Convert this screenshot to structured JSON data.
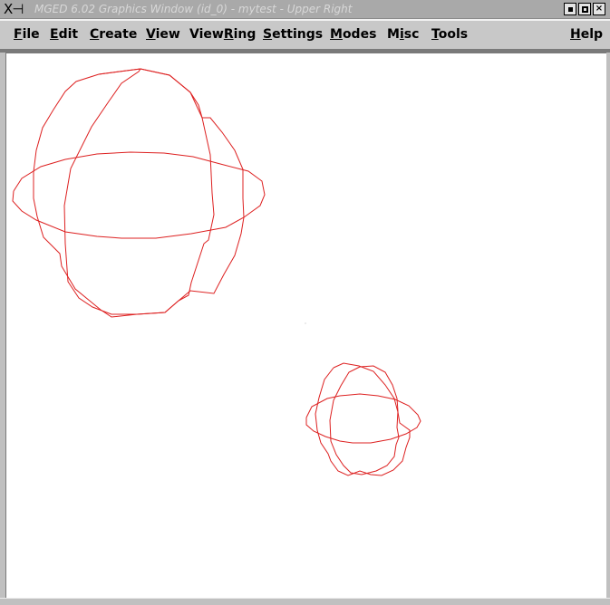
{
  "window": {
    "title": "MGED 6.02 Graphics Window (id_0) - mytest - Upper Right",
    "icon_label": "X⊣",
    "controls": {
      "minimize": "minimize",
      "maximize": "maximize",
      "close": "×"
    }
  },
  "menubar": {
    "items": [
      {
        "pre": "",
        "u": "F",
        "post": "ile"
      },
      {
        "pre": "",
        "u": "E",
        "post": "dit"
      },
      {
        "pre": "",
        "u": "C",
        "post": "reate"
      },
      {
        "pre": "",
        "u": "V",
        "post": "iew"
      },
      {
        "pre": "View",
        "u": "R",
        "post": "ing"
      },
      {
        "pre": "",
        "u": "S",
        "post": "ettings"
      },
      {
        "pre": "",
        "u": "M",
        "post": "odes"
      },
      {
        "pre": "M",
        "u": "i",
        "post": "sc"
      },
      {
        "pre": "",
        "u": "T",
        "post": "ools"
      },
      {
        "pre": "",
        "u": "H",
        "post": "elp"
      }
    ]
  },
  "canvas": {
    "background": "#ffffff",
    "wire_color": "#dd2020",
    "objects": [
      {
        "name": "large-sphere",
        "kind": "wireframe-sphere"
      },
      {
        "name": "small-sphere",
        "kind": "wireframe-sphere"
      }
    ]
  },
  "colors": {
    "titlebar": "#a9a9a9",
    "menubar": "#c8c8c8",
    "frame": "#c0c0c0"
  }
}
